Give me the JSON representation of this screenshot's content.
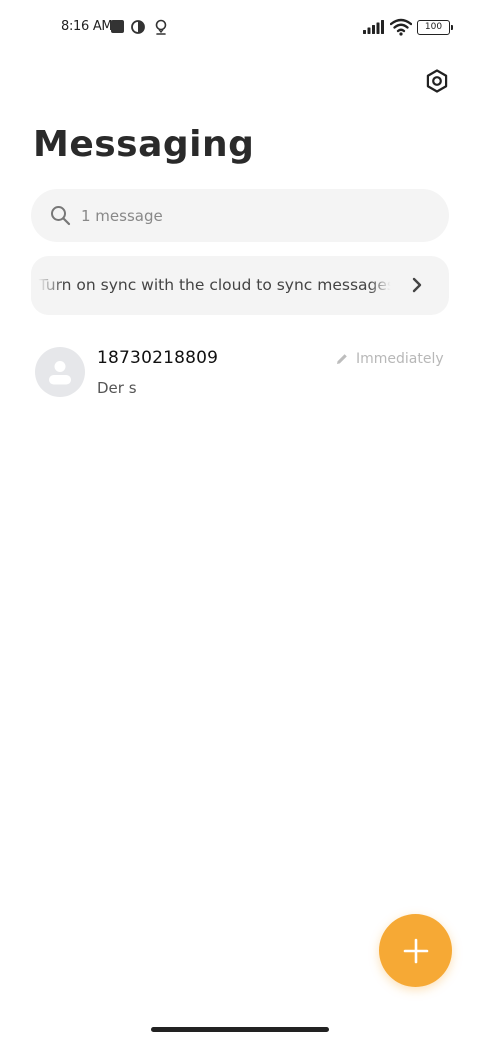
{
  "status_bar": {
    "time": "8:16 AM",
    "battery": "100",
    "icons": [
      "notification-square-icon",
      "data-saver-icon",
      "location-pin-icon",
      "signal-icon",
      "wifi-icon",
      "battery-icon"
    ]
  },
  "header": {
    "title": "Messaging",
    "settings_icon": "gear-icon"
  },
  "search": {
    "placeholder": "1 message",
    "icon": "search-icon"
  },
  "sync_banner": {
    "text": "Turn on sync with the cloud to sync messages",
    "icon": "chevron-right-icon"
  },
  "conversations": [
    {
      "name": "18730218809",
      "snippet": "Der s",
      "time": "Immediately",
      "status_icon": "draft-pencil-icon"
    }
  ],
  "fab": {
    "icon": "plus-icon",
    "color": "#F6A935"
  },
  "colors": {
    "accent": "#F6A935",
    "surface": "#F4F4F4",
    "background": "#FFFFFF"
  }
}
